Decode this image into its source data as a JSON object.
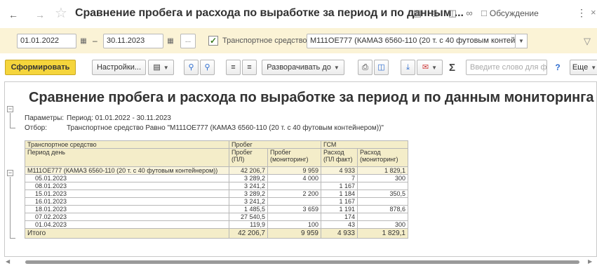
{
  "window": {
    "title": "Сравнение пробега и расхода по выработке за период и по данным ...",
    "discuss_label": "Обсуждение"
  },
  "filters": {
    "date_from": "01.01.2022",
    "date_to": "30.11.2023",
    "dash": "–",
    "dots_label": "...",
    "vehicle_checked": true,
    "vehicle_label": "Транспортное средство:",
    "vehicle_value": "М111ОЕ777 (КАМАЗ 6560-110 (20 т. с 40 футовым контейне"
  },
  "toolbar": {
    "generate_label": "Сформировать",
    "settings_label": "Настройки...",
    "expand_label": "Разворачивать до",
    "search_placeholder": "Введите слово для фи...",
    "help_label": "?",
    "more_label": "Еще"
  },
  "report": {
    "title": "Сравнение пробега и расхода по выработке за период и по данным мониторинга",
    "params_label": "Параметры:",
    "params_value": "Период: 01.01.2022 - 30.11.2023",
    "filter_label": "Отбор:",
    "filter_value": "Транспортное средство Равно \"М111ОЕ777 (КАМАЗ 6560-110 (20 т. с 40 футовым контейнером))\"",
    "header": {
      "col1_row1": "Транспортное средство",
      "col1_row2": "Период день",
      "group_mileage": "Пробег",
      "group_fuel": "ГСМ",
      "mileage_pl": "Пробег (ПЛ)",
      "mileage_mon": "Пробег (мониторинг)",
      "fuel_fact": "Расход (ПЛ факт)",
      "fuel_mon": "Расход (мониторинг)"
    },
    "group_row": {
      "name": "М111ОЕ777 (КАМАЗ 6560-110 (20 т. с 40 футовым контейнером))",
      "mileage_pl": "42 206,7",
      "mileage_mon": "9 959",
      "fuel_fact": "4 933",
      "fuel_mon": "1 829,1"
    },
    "rows": [
      {
        "date": "05.01.2023",
        "mileage_pl": "3 289,2",
        "mileage_mon": "4 000",
        "fuel_fact": "7",
        "fuel_mon": "300"
      },
      {
        "date": "08.01.2023",
        "mileage_pl": "3 241,2",
        "mileage_mon": "",
        "fuel_fact": "1 167",
        "fuel_mon": ""
      },
      {
        "date": "15.01.2023",
        "mileage_pl": "3 289,2",
        "mileage_mon": "2 200",
        "fuel_fact": "1 184",
        "fuel_mon": "350,5"
      },
      {
        "date": "16.01.2023",
        "mileage_pl": "3 241,2",
        "mileage_mon": "",
        "fuel_fact": "1 167",
        "fuel_mon": ""
      },
      {
        "date": "18.01.2023",
        "mileage_pl": "1 485,5",
        "mileage_mon": "3 659",
        "fuel_fact": "1 191",
        "fuel_mon": "878,6"
      },
      {
        "date": "07.02.2023",
        "mileage_pl": "27 540,5",
        "mileage_mon": "",
        "fuel_fact": "174",
        "fuel_mon": ""
      },
      {
        "date": "01.04.2023",
        "mileage_pl": "119,9",
        "mileage_mon": "100",
        "fuel_fact": "43",
        "fuel_mon": "300"
      }
    ],
    "total": {
      "label": "Итого",
      "mileage_pl": "42 206,7",
      "mileage_mon": "9 959",
      "fuel_fact": "4 933",
      "fuel_mon": "1 829,1"
    }
  }
}
